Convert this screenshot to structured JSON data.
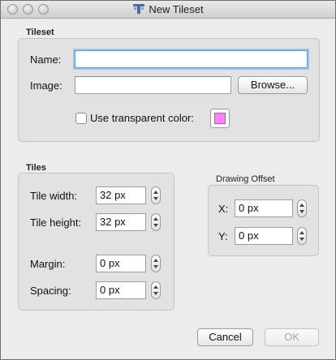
{
  "window": {
    "title": "New Tileset"
  },
  "tileset": {
    "section_label": "Tileset",
    "name_label": "Name:",
    "name_value": "",
    "image_label": "Image:",
    "image_value": "",
    "browse_label": "Browse...",
    "transparent_label": "Use transparent color:",
    "transparent_checked": false,
    "transparent_color": "#ff80ff"
  },
  "tiles": {
    "section_label": "Tiles",
    "width_label": "Tile width:",
    "width_value": "32 px",
    "height_label": "Tile height:",
    "height_value": "32 px",
    "margin_label": "Margin:",
    "margin_value": "0 px",
    "spacing_label": "Spacing:",
    "spacing_value": "0 px"
  },
  "offset": {
    "section_label": "Drawing Offset",
    "x_label": "X:",
    "x_value": "0 px",
    "y_label": "Y:",
    "y_value": "0 px"
  },
  "buttons": {
    "cancel_label": "Cancel",
    "ok_label": "OK"
  },
  "colors": {
    "accent_focus": "#5b9ad9"
  }
}
